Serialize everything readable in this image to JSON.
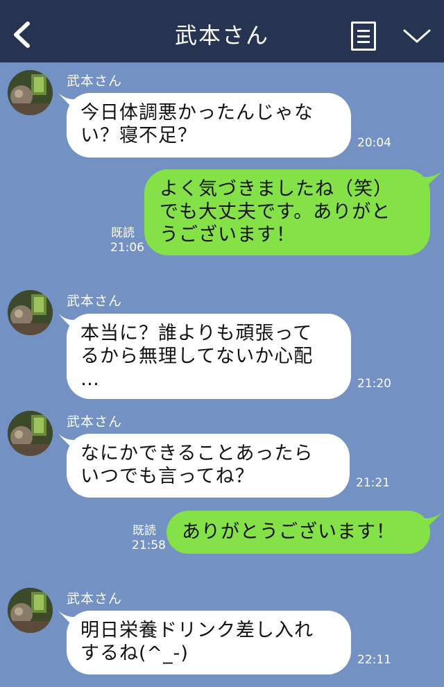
{
  "header": {
    "title": "武本さん",
    "back_icon": "chevron-left-icon",
    "menu_icon": "notes-icon",
    "expand_icon": "chevron-down-icon",
    "background": "#263451"
  },
  "chat": {
    "background": "#7391c2",
    "incoming_bubble_color": "#ffffff",
    "outgoing_bubble_color": "#84e147",
    "messages": [
      {
        "from": "incoming",
        "sender": "武本さん",
        "lines": [
          "今日体調悪かったんじゃな",
          "い？寝不足？"
        ],
        "time": "20:04"
      },
      {
        "from": "outgoing",
        "lines": [
          "よく気づきましたね（笑）",
          "でも大丈夫です。ありがと",
          "うございます！"
        ],
        "read": "既読",
        "time": "21:06"
      },
      {
        "from": "incoming",
        "sender": "武本さん",
        "lines": [
          "本当に？誰よりも頑張って",
          "るから無理してないか心配",
          "…"
        ],
        "time": "21:20"
      },
      {
        "from": "incoming",
        "sender": "武本さん",
        "lines": [
          "なにかできることあったら",
          "いつでも言ってね？"
        ],
        "time": "21:21"
      },
      {
        "from": "outgoing",
        "lines": [
          "ありがとうございます！"
        ],
        "read": "既読",
        "time": "21:58"
      },
      {
        "from": "incoming",
        "sender": "武本さん",
        "lines": [
          "明日栄養ドリンク差し入れ",
          "するね(^_-)"
        ],
        "time": "22:11"
      }
    ]
  }
}
